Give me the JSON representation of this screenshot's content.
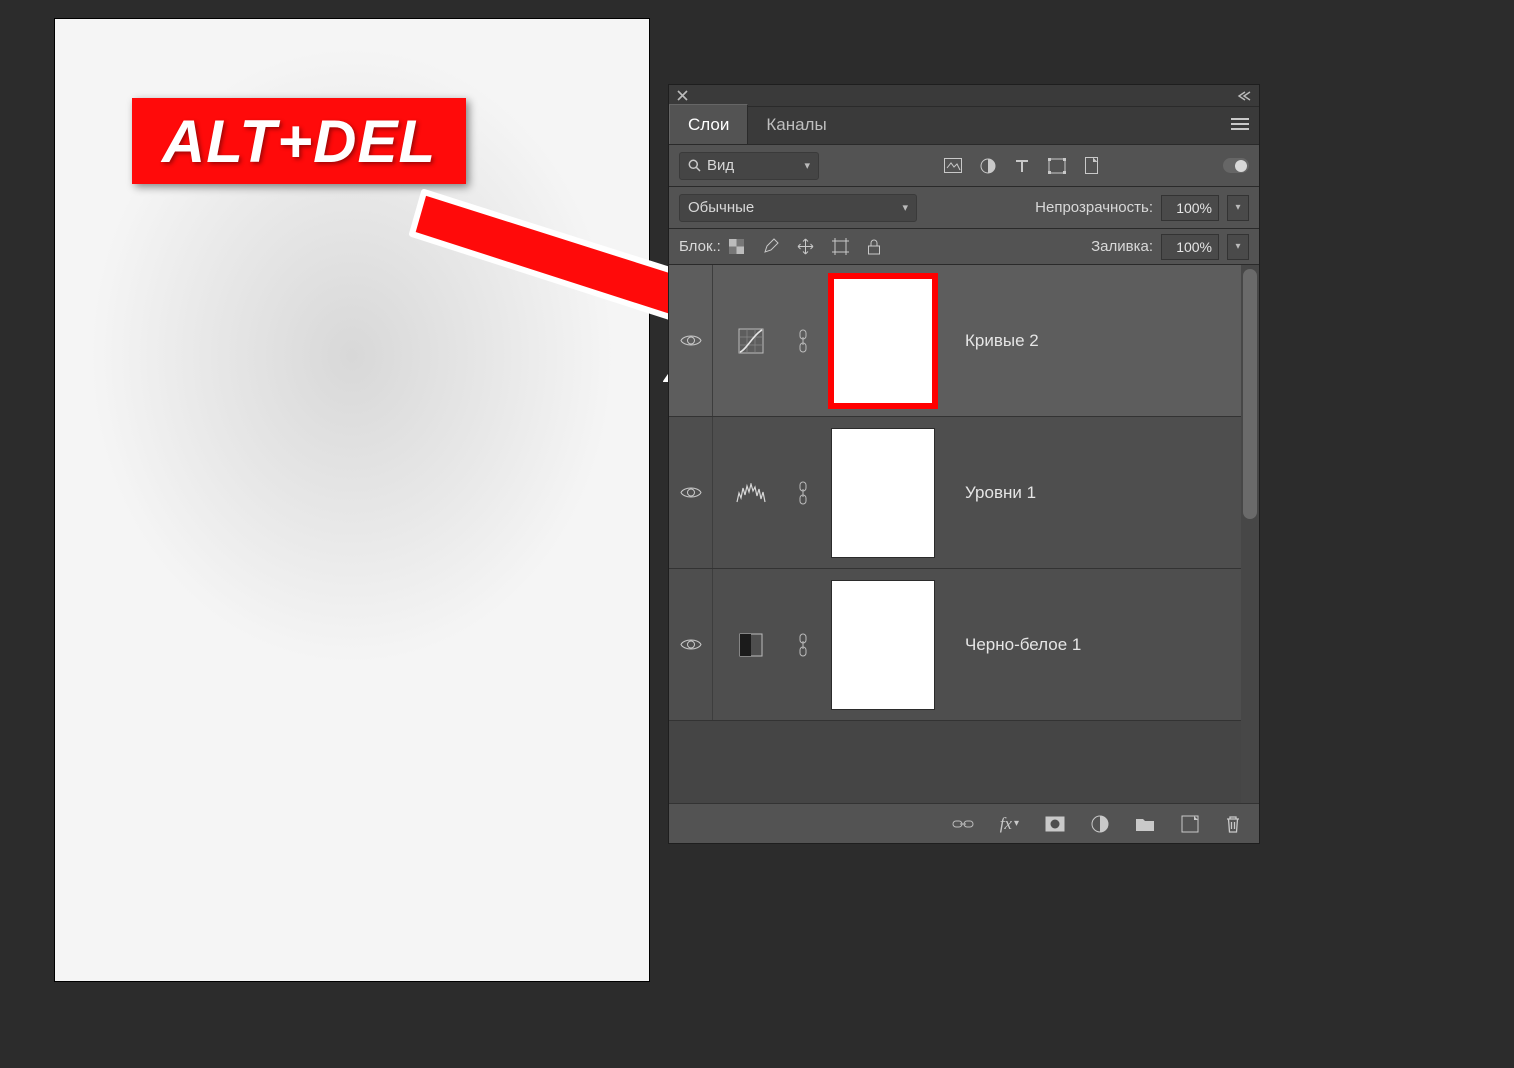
{
  "badge": {
    "text": "ALT+DEL"
  },
  "panel": {
    "tabs": {
      "layers": "Слои",
      "channels": "Каналы"
    },
    "filter": {
      "kind_label": "Вид"
    },
    "blend": {
      "mode": "Обычные",
      "opacity_label": "Непрозрачность:",
      "opacity_value": "100%"
    },
    "lock": {
      "label": "Блок.:",
      "fill_label": "Заливка:",
      "fill_value": "100%"
    },
    "layers": [
      {
        "name": "Кривые 2",
        "type": "curves",
        "selected": true,
        "mask_highlight": true
      },
      {
        "name": "Уровни 1",
        "type": "levels",
        "selected": false,
        "mask_highlight": false
      },
      {
        "name": "Черно-белое 1",
        "type": "bw",
        "selected": false,
        "mask_highlight": false
      }
    ]
  }
}
